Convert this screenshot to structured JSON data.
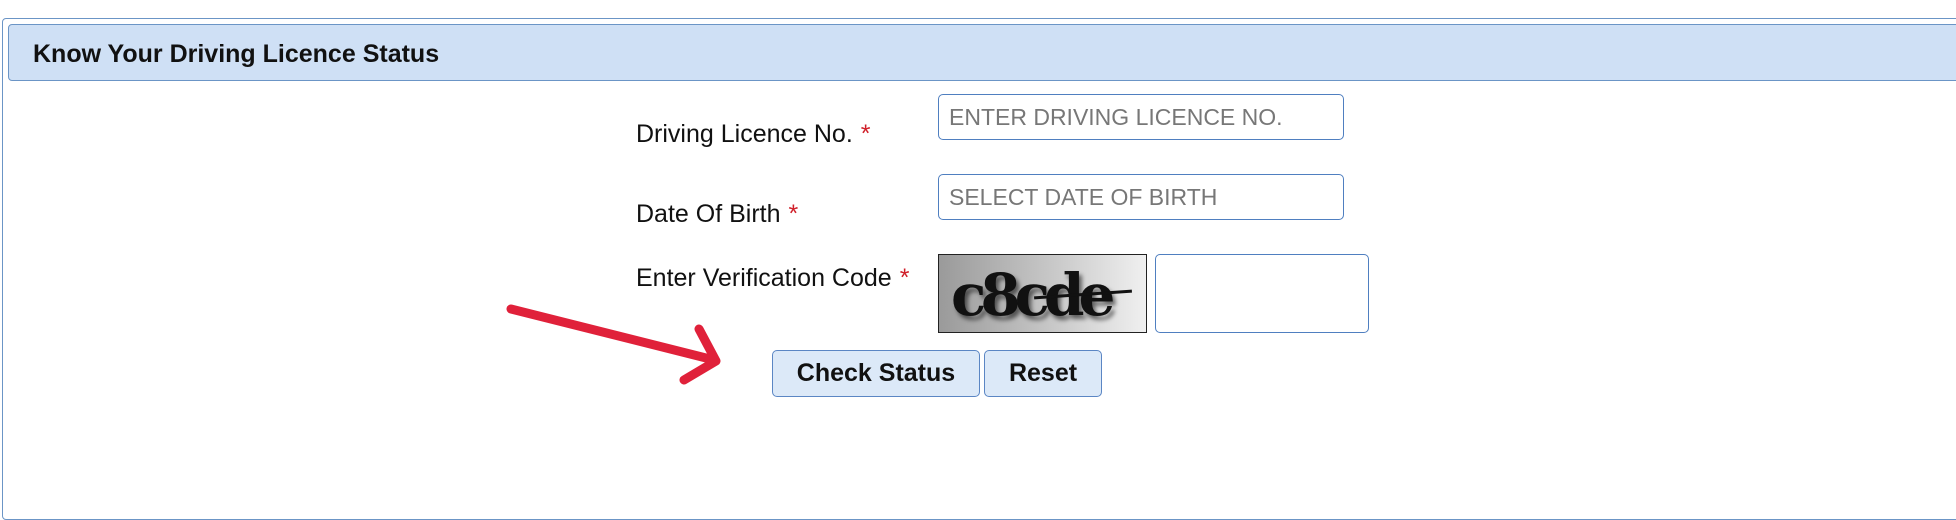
{
  "panel": {
    "title": "Know Your Driving Licence Status"
  },
  "form": {
    "licence_label": "Driving Licence No.",
    "licence_placeholder": "ENTER DRIVING LICENCE NO.",
    "licence_value": "",
    "dob_label": "Date Of Birth",
    "dob_placeholder": "SELECT DATE OF BIRTH",
    "dob_value": "",
    "captcha_label": "Enter Verification Code",
    "captcha_image_text": "c8cde",
    "captcha_value": "",
    "required_marker": "*"
  },
  "buttons": {
    "check_status": "Check Status",
    "reset": "Reset"
  },
  "colors": {
    "header_bg": "#cfe0f5",
    "border": "#6b95c6",
    "required": "#d0202a",
    "button_bg": "#dce9f8",
    "annotation_arrow": "#e0213a"
  }
}
